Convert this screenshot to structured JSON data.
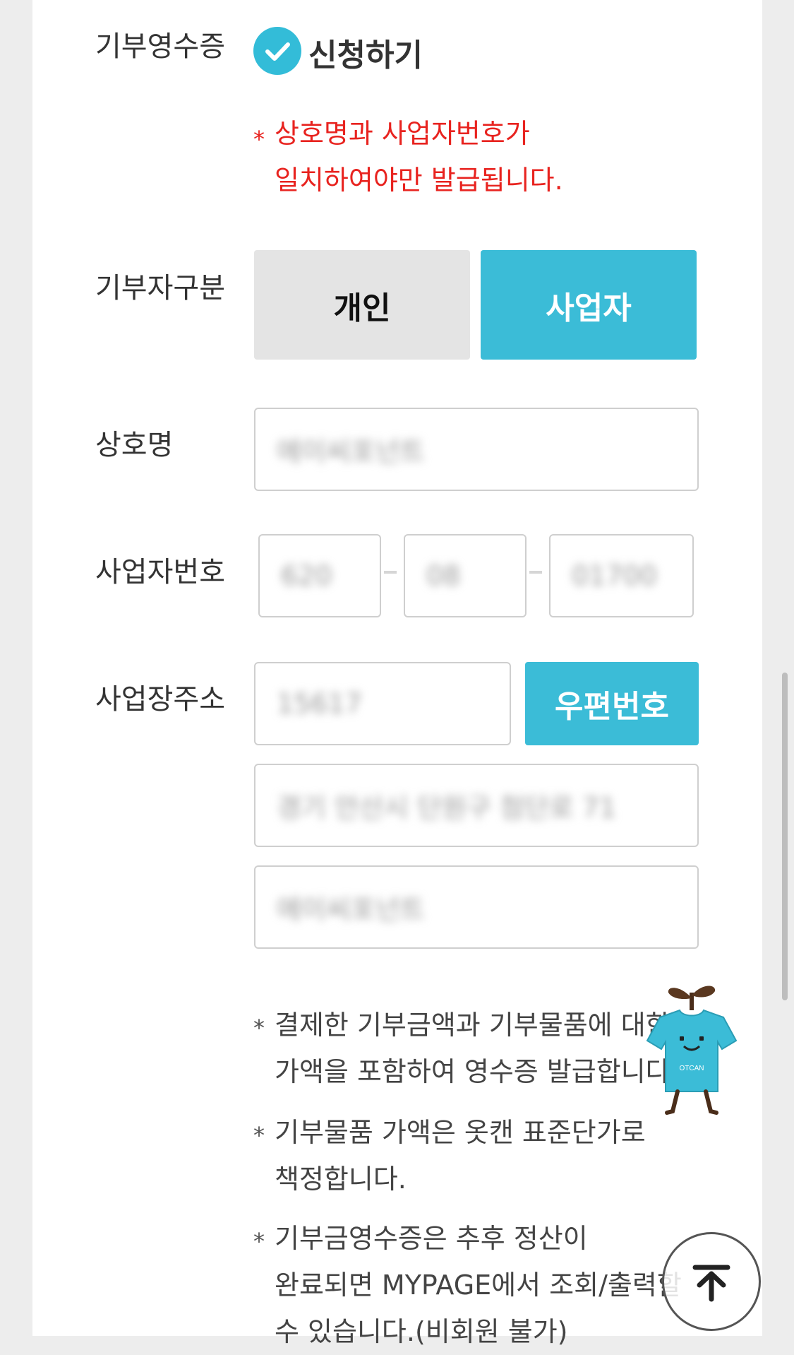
{
  "receipt": {
    "label": "기부영수증",
    "checkbox_label": "신청하기",
    "checked": true,
    "warning_star": "*",
    "warning_lines": [
      "상호명과 사업자번호가",
      "일치하여야만 발급됩니다."
    ]
  },
  "donor_type": {
    "label": "기부자구분",
    "options": [
      "개인",
      "사업자"
    ],
    "selected": "사업자"
  },
  "company_name": {
    "label": "상호명",
    "value": "에이씨포넌트"
  },
  "business_number": {
    "label": "사업자번호",
    "parts": [
      "620",
      "08",
      "01700"
    ]
  },
  "business_address": {
    "label": "사업장주소",
    "zip": "15617",
    "zip_button": "우편번호",
    "address1": "경기 안산시 단원구 첨단로 71",
    "address2": "에이씨포넌트"
  },
  "notes": [
    {
      "star": "*",
      "lines": [
        "결제한 기부금액과 기부물품에 대한",
        "가액을 포함하여 영수증 발급합니다."
      ]
    },
    {
      "star": "*",
      "lines": [
        "기부물품 가액은 옷캔 표준단가로",
        "책정합니다."
      ]
    },
    {
      "star": "*",
      "lines": [
        "기부금영수증은 추후 정산이",
        "완료되면 MYPAGE에서 조회/출력할",
        "수 있습니다.(비회원 불가)"
      ]
    }
  ],
  "mascot": {
    "text": "OTCAN"
  },
  "colors": {
    "accent": "#3bbcd7",
    "warning": "#e8231f"
  }
}
